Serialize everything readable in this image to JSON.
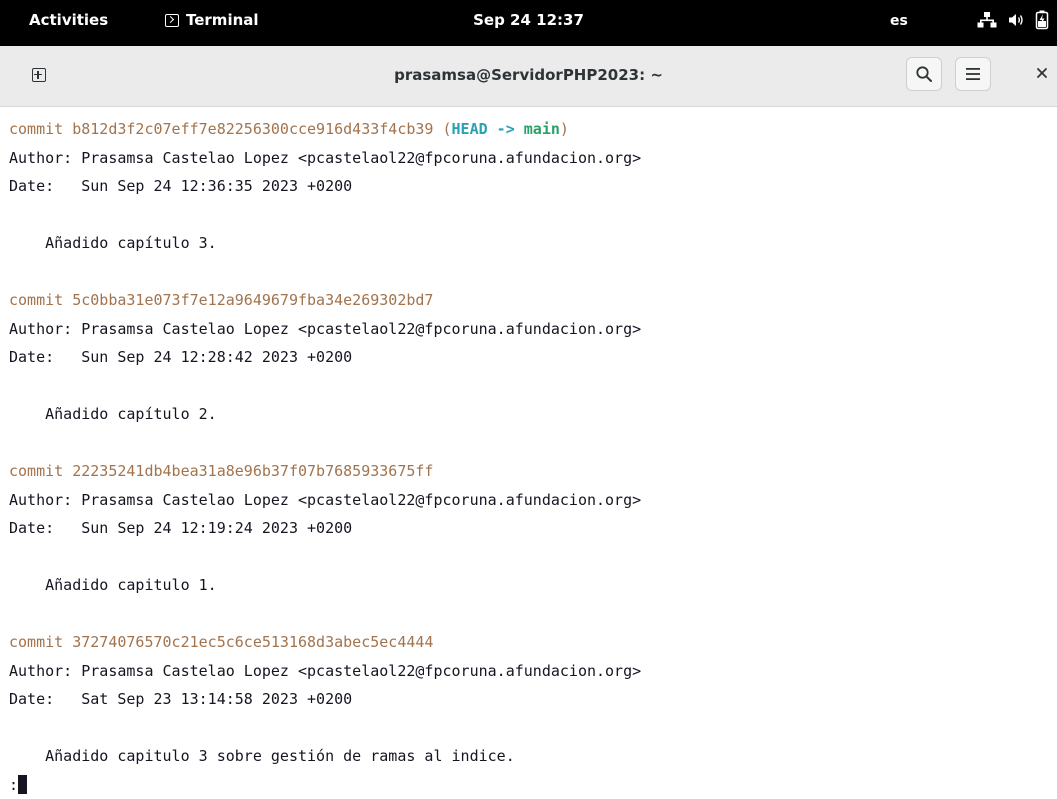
{
  "topbar": {
    "activities": "Activities",
    "app_name": "Terminal",
    "clock": "Sep 24  12:37",
    "lang": "es",
    "icons": [
      "terminal-icon",
      "network-icon",
      "volume-icon",
      "battery-icon"
    ]
  },
  "window": {
    "title": "prasamsa@ServidorPHP2023: ~",
    "buttons": [
      "new-tab",
      "search",
      "menu",
      "close"
    ]
  },
  "terminal": {
    "commits": [
      {
        "prefix": "commit ",
        "hash": "b812d3f2c07eff7e82256300cce916d433f4cb39",
        "ref_open": " (",
        "head": "HEAD -> ",
        "branch": "main",
        "ref_close": ")",
        "author": "Author: Prasamsa Castelao Lopez <pcastelaol22@fpcoruna.afundacion.org>",
        "date": "Date:   Sun Sep 24 12:36:35 2023 +0200",
        "message": "    Añadido capítulo 3."
      },
      {
        "prefix": "commit ",
        "hash": "5c0bba31e073f7e12a9649679fba34e269302bd7",
        "author": "Author: Prasamsa Castelao Lopez <pcastelaol22@fpcoruna.afundacion.org>",
        "date": "Date:   Sun Sep 24 12:28:42 2023 +0200",
        "message": "    Añadido capítulo 2."
      },
      {
        "prefix": "commit ",
        "hash": "22235241db4bea31a8e96b37f07b7685933675ff",
        "author": "Author: Prasamsa Castelao Lopez <pcastelaol22@fpcoruna.afundacion.org>",
        "date": "Date:   Sun Sep 24 12:19:24 2023 +0200",
        "message": "    Añadido capitulo 1."
      },
      {
        "prefix": "commit ",
        "hash": "37274076570c21ec5c6ce513168d3abec5ec4444",
        "author": "Author: Prasamsa Castelao Lopez <pcastelaol22@fpcoruna.afundacion.org>",
        "date": "Date:   Sat Sep 23 13:14:58 2023 +0200",
        "message": "    Añadido capitulo 3 sobre gestión de ramas al indice."
      }
    ],
    "prompt": ":"
  },
  "colors": {
    "hash": "#a2734c",
    "head": "#2aa1b3",
    "branch": "#26a269",
    "terminal_bg": "#ffffff",
    "topbar_bg": "#000000"
  }
}
